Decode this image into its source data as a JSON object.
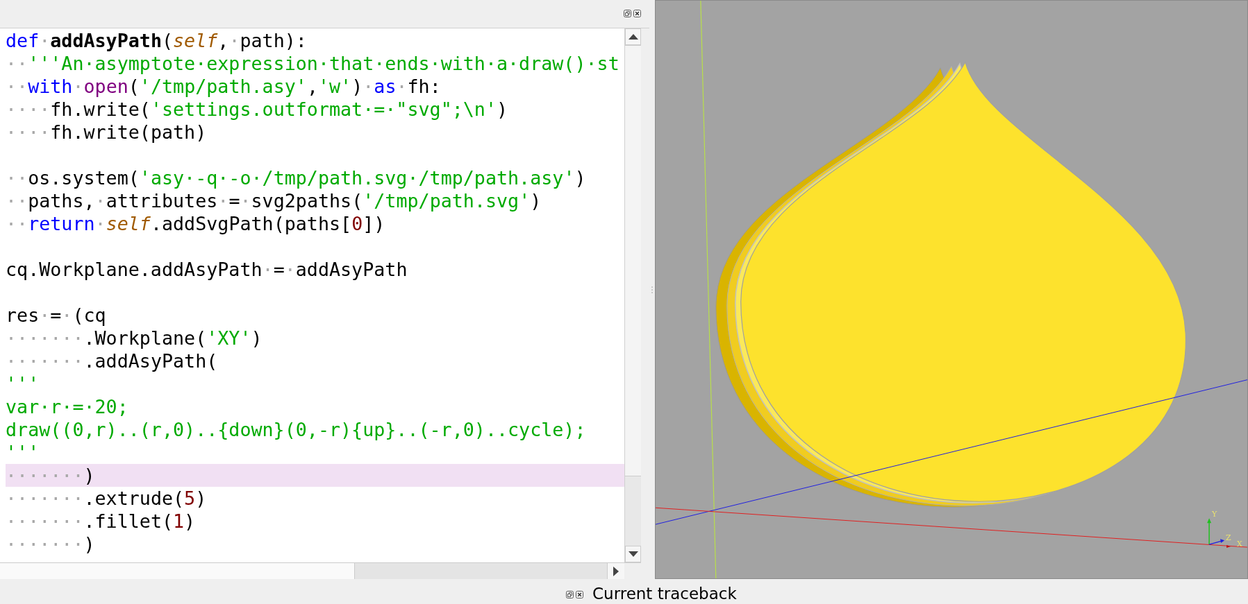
{
  "editor": {
    "lines": [
      {
        "highlighted": false,
        "tokens": [
          {
            "kind": "keyword",
            "text": "def"
          },
          {
            "kind": "ws",
            "text": "·"
          },
          {
            "kind": "funcname",
            "text": "addAsyPath"
          },
          {
            "kind": "plain",
            "text": "("
          },
          {
            "kind": "self",
            "text": "self"
          },
          {
            "kind": "plain",
            "text": ","
          },
          {
            "kind": "ws",
            "text": "·"
          },
          {
            "kind": "plain",
            "text": "path):"
          }
        ]
      },
      {
        "highlighted": false,
        "tokens": [
          {
            "kind": "ws",
            "text": "··"
          },
          {
            "kind": "string",
            "text": "'''An·asymptote·expression·that·ends·with·a·draw()·st"
          }
        ]
      },
      {
        "highlighted": false,
        "tokens": [
          {
            "kind": "ws",
            "text": "··"
          },
          {
            "kind": "keyword",
            "text": "with"
          },
          {
            "kind": "ws",
            "text": "·"
          },
          {
            "kind": "builtin",
            "text": "open"
          },
          {
            "kind": "plain",
            "text": "("
          },
          {
            "kind": "string",
            "text": "'/tmp/path.asy'"
          },
          {
            "kind": "plain",
            "text": ","
          },
          {
            "kind": "string",
            "text": "'w'"
          },
          {
            "kind": "plain",
            "text": ")"
          },
          {
            "kind": "ws",
            "text": "·"
          },
          {
            "kind": "keyword",
            "text": "as"
          },
          {
            "kind": "ws",
            "text": "·"
          },
          {
            "kind": "plain",
            "text": "fh:"
          }
        ]
      },
      {
        "highlighted": false,
        "tokens": [
          {
            "kind": "ws",
            "text": "····"
          },
          {
            "kind": "plain",
            "text": "fh.write("
          },
          {
            "kind": "string",
            "text": "'settings.outformat·=·\"svg\";\\n'"
          },
          {
            "kind": "plain",
            "text": ")"
          }
        ]
      },
      {
        "highlighted": false,
        "tokens": [
          {
            "kind": "ws",
            "text": "····"
          },
          {
            "kind": "plain",
            "text": "fh.write(path)"
          }
        ]
      },
      {
        "highlighted": false,
        "blank_before": true,
        "tokens": [
          {
            "kind": "ws",
            "text": "··"
          },
          {
            "kind": "plain",
            "text": "os.system("
          },
          {
            "kind": "string",
            "text": "'asy·-q·-o·/tmp/path.svg·/tmp/path.asy'"
          },
          {
            "kind": "plain",
            "text": ")"
          }
        ]
      },
      {
        "highlighted": false,
        "tokens": [
          {
            "kind": "ws",
            "text": "··"
          },
          {
            "kind": "plain",
            "text": "paths,"
          },
          {
            "kind": "ws",
            "text": "·"
          },
          {
            "kind": "plain",
            "text": "attributes"
          },
          {
            "kind": "ws",
            "text": "·"
          },
          {
            "kind": "plain",
            "text": "="
          },
          {
            "kind": "ws",
            "text": "·"
          },
          {
            "kind": "plain",
            "text": "svg2paths("
          },
          {
            "kind": "string",
            "text": "'/tmp/path.svg'"
          },
          {
            "kind": "plain",
            "text": ")"
          }
        ]
      },
      {
        "highlighted": false,
        "tokens": [
          {
            "kind": "ws",
            "text": "··"
          },
          {
            "kind": "keyword",
            "text": "return"
          },
          {
            "kind": "ws",
            "text": "·"
          },
          {
            "kind": "self",
            "text": "self"
          },
          {
            "kind": "plain",
            "text": ".addSvgPath(paths["
          },
          {
            "kind": "number",
            "text": "0"
          },
          {
            "kind": "plain",
            "text": "])"
          }
        ]
      },
      {
        "highlighted": false,
        "blank_before": true,
        "tokens": [
          {
            "kind": "plain",
            "text": "cq.Workplane.addAsyPath"
          },
          {
            "kind": "ws",
            "text": "·"
          },
          {
            "kind": "plain",
            "text": "="
          },
          {
            "kind": "ws",
            "text": "·"
          },
          {
            "kind": "plain",
            "text": "addAsyPath"
          }
        ]
      },
      {
        "highlighted": false,
        "blank_before": true,
        "tokens": [
          {
            "kind": "plain",
            "text": "res"
          },
          {
            "kind": "ws",
            "text": "·"
          },
          {
            "kind": "plain",
            "text": "="
          },
          {
            "kind": "ws",
            "text": "·"
          },
          {
            "kind": "plain",
            "text": "(cq"
          }
        ]
      },
      {
        "highlighted": false,
        "tokens": [
          {
            "kind": "ws",
            "text": "·······"
          },
          {
            "kind": "plain",
            "text": ".Workplane("
          },
          {
            "kind": "string",
            "text": "'XY'"
          },
          {
            "kind": "plain",
            "text": ")"
          }
        ]
      },
      {
        "highlighted": false,
        "tokens": [
          {
            "kind": "ws",
            "text": "·······"
          },
          {
            "kind": "plain",
            "text": ".addAsyPath("
          }
        ]
      },
      {
        "highlighted": false,
        "tokens": [
          {
            "kind": "string",
            "text": "'''"
          }
        ]
      },
      {
        "highlighted": false,
        "tokens": [
          {
            "kind": "string",
            "text": "var·r·=·20;"
          }
        ]
      },
      {
        "highlighted": false,
        "tokens": [
          {
            "kind": "string",
            "text": "draw((0,r)..(r,0)..{down}(0,-r){up}..(-r,0)..cycle);"
          }
        ]
      },
      {
        "highlighted": false,
        "tokens": [
          {
            "kind": "string",
            "text": "'''"
          }
        ]
      },
      {
        "highlighted": true,
        "tokens": [
          {
            "kind": "ws",
            "text": "·······"
          },
          {
            "kind": "plain",
            "text": ")"
          }
        ]
      },
      {
        "highlighted": false,
        "tokens": [
          {
            "kind": "ws",
            "text": "·······"
          },
          {
            "kind": "plain",
            "text": ".extrude("
          },
          {
            "kind": "number",
            "text": "5"
          },
          {
            "kind": "plain",
            "text": ")"
          }
        ]
      },
      {
        "highlighted": false,
        "tokens": [
          {
            "kind": "ws",
            "text": "·······"
          },
          {
            "kind": "plain",
            "text": ".fillet("
          },
          {
            "kind": "number",
            "text": "1"
          },
          {
            "kind": "plain",
            "text": ")"
          }
        ]
      },
      {
        "highlighted": false,
        "tokens": [
          {
            "kind": "ws",
            "text": "·······"
          },
          {
            "kind": "plain",
            "text": ")"
          }
        ]
      }
    ]
  },
  "viewer": {
    "axis_labels": [
      "Y",
      "Z",
      "X"
    ]
  },
  "traceback_panel": {
    "title": "Current traceback"
  }
}
